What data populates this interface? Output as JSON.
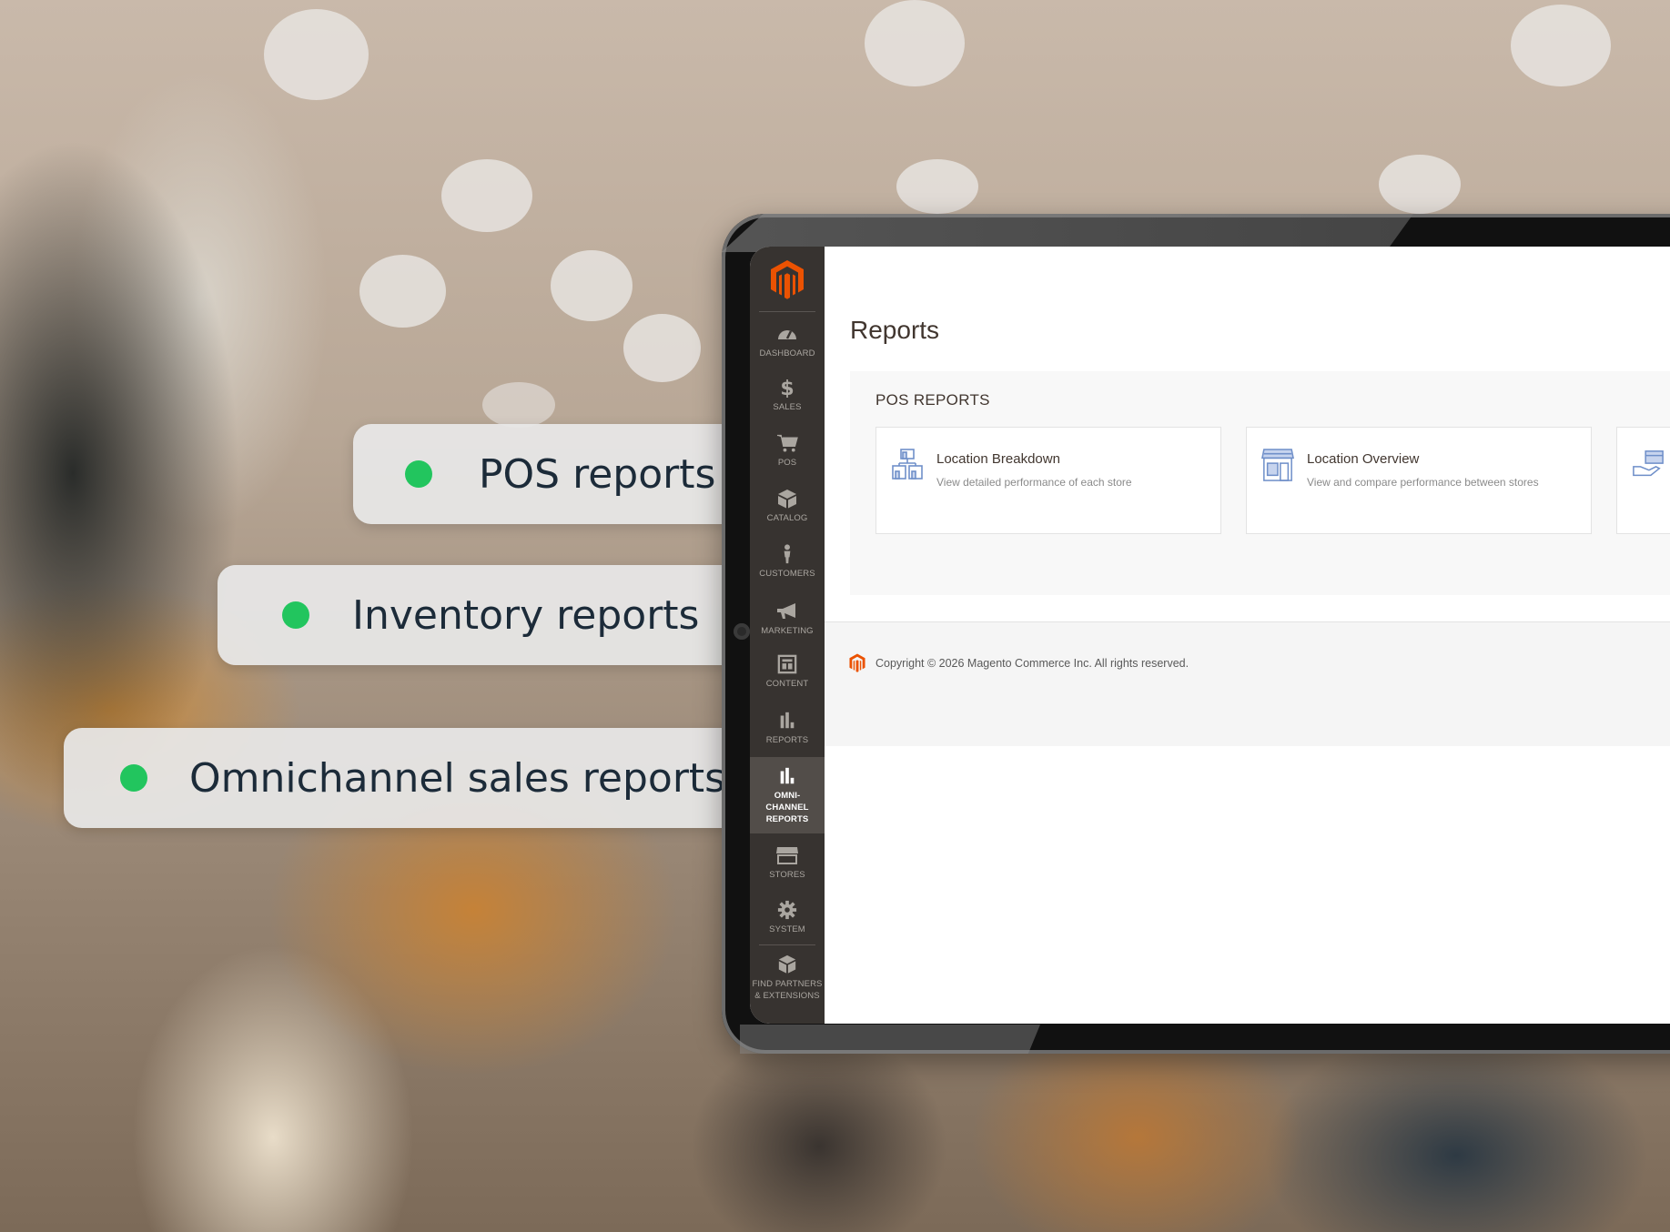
{
  "features": [
    {
      "label": "POS reports"
    },
    {
      "label": "Inventory reports"
    },
    {
      "label": "Omnichannel sales reports"
    }
  ],
  "colors": {
    "accent_dot": "#22c55e",
    "magento_orange": "#eb5202",
    "sidebar_bg": "#373330"
  },
  "sidebar": {
    "items": [
      {
        "label": "DASHBOARD",
        "icon": "gauge-icon"
      },
      {
        "label": "SALES",
        "icon": "dollar-icon"
      },
      {
        "label": "POS",
        "icon": "cart-icon"
      },
      {
        "label": "CATALOG",
        "icon": "box-icon"
      },
      {
        "label": "CUSTOMERS",
        "icon": "person-icon"
      },
      {
        "label": "MARKETING",
        "icon": "megaphone-icon"
      },
      {
        "label": "CONTENT",
        "icon": "layout-icon"
      },
      {
        "label": "REPORTS",
        "icon": "bar-chart-icon"
      },
      {
        "label": "OMNI-\nCHANNEL\nREPORTS",
        "icon": "bar-chart-icon",
        "active": true
      },
      {
        "label": "STORES",
        "icon": "storefront-icon"
      },
      {
        "label": "SYSTEM",
        "icon": "gear-icon"
      },
      {
        "label": "FIND PARTNERS\n& EXTENSIONS",
        "icon": "cube-icon"
      }
    ]
  },
  "page": {
    "title": "Reports",
    "section_title": "POS REPORTS",
    "cards": [
      {
        "title": "Location Breakdown",
        "subtitle": "View detailed performance of each store",
        "icon": "stores-icon"
      },
      {
        "title": "Location Overview",
        "subtitle": "View and compare performance between stores",
        "icon": "store-front-icon"
      },
      {
        "title": "",
        "subtitle": "",
        "icon": "payment-hand-icon"
      }
    ]
  },
  "footer": {
    "copyright": "Copyright © 2026 Magento Commerce Inc. All rights reserved."
  }
}
